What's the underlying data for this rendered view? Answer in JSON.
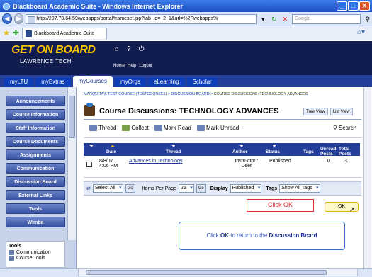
{
  "window": {
    "title": "Blackboard Academic Suite - Windows Internet Explorer",
    "controls": [
      "_",
      "□",
      "X"
    ]
  },
  "addressbar": {
    "url": "http://207.73.64.59/webapps/portal/frameset.jsp?tab_id=_2_1&url=%2Fwebapps%",
    "search_placeholder": "Google"
  },
  "tabbar": {
    "tab_label": "Blackboard Academic Suite"
  },
  "header": {
    "logo_line1": "GET ON BOARD",
    "logo_line2": "LAWRENCE TECH",
    "links": [
      "Home",
      "Help",
      "Logout"
    ]
  },
  "nav": {
    "tabs": [
      {
        "label": "myLTU",
        "active": false
      },
      {
        "label": "myExtras",
        "active": false
      },
      {
        "label": "myCourses",
        "active": true
      },
      {
        "label": "myOrgs",
        "active": false
      },
      {
        "label": "eLearning",
        "active": false
      },
      {
        "label": "Scholar",
        "active": false
      }
    ]
  },
  "sidebar": {
    "items": [
      "Announcements",
      "Course Information",
      "Staff Information",
      "Course Documents",
      "Assignments",
      "Communication",
      "Discussion Board",
      "External Links",
      "Tools",
      "Wimba"
    ],
    "tools_header": "Tools",
    "tools_items": [
      "Communication",
      "Course Tools"
    ]
  },
  "breadcrumb": {
    "parts": [
      "MARQUITA'S TEST COURSE (TESTCOURSE1)",
      "DISCUSSION BOARD"
    ],
    "current": "COURSE DISCUSSIONS: TECHNOLOGY ADVANCES"
  },
  "page": {
    "title": "Course Discussions: TECHNOLOGY ADVANCES",
    "view_tree": "Tree View",
    "view_list": "List View"
  },
  "toolbar": {
    "items": [
      "Thread",
      "Collect",
      "Mark Read",
      "Mark Unread"
    ],
    "search": "Search"
  },
  "grid": {
    "headers": [
      "Date",
      "Thread",
      "Author",
      "Status",
      "Tags",
      "Unread Posts",
      "Total Posts"
    ],
    "rows": [
      {
        "date": "8/8/07 4:06 PM",
        "thread": "Advances in Technology",
        "author": "Instructor7 User",
        "status": "Published",
        "tags": "",
        "unread": "0",
        "total": "3"
      }
    ]
  },
  "bottombar": {
    "select_all": "Select All",
    "go": "Go",
    "items_per_page_label": "Items Per Page",
    "items_per_page": "25",
    "display_label": "Display",
    "display_value": "Published",
    "tags_label": "Tags",
    "tags_value": "Show All Tags"
  },
  "callouts": {
    "click_ok": "Click OK",
    "ok_button": "OK",
    "info_pre": "Click",
    "info_ok": "OK",
    "info_mid": "to return to the",
    "info_target": "Discussion Board"
  }
}
